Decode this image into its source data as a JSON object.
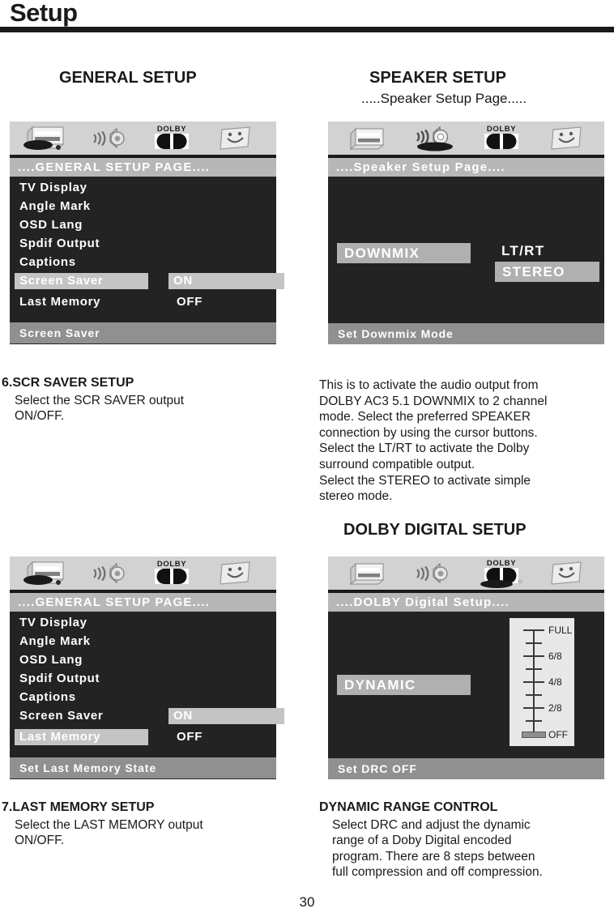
{
  "header": {
    "title": "Setup"
  },
  "page_number": "30",
  "sections": {
    "general_setup_heading": "GENERAL SETUP",
    "speaker_setup_heading": "SPEAKER SETUP",
    "speaker_setup_subheading": ".....Speaker Setup Page.....",
    "dolby_digital_heading": "DOLBY DIGITAL SETUP"
  },
  "icons": {
    "tv": "tv-display-icon",
    "speaker": "speaker-icon",
    "dolby": "dolby-icon",
    "preference": "preference-smiley-icon",
    "dolby_label": "DOLBY"
  },
  "panel_general_screensaver": {
    "title": "....GENERAL SETUP PAGE....",
    "menu": [
      {
        "label": "TV Display",
        "selected": false
      },
      {
        "label": "Angle Mark",
        "selected": false
      },
      {
        "label": "OSD Lang",
        "selected": false
      },
      {
        "label": "Spdif Output",
        "selected": false
      },
      {
        "label": "Captions",
        "selected": false
      },
      {
        "label": "Screen Saver",
        "selected": true
      },
      {
        "label": "Last Memory",
        "selected": false
      }
    ],
    "options": [
      {
        "label": "ON",
        "selected": true
      },
      {
        "label": "OFF",
        "selected": false
      }
    ],
    "status": "Screen Saver",
    "active_icon": "tv-display-icon"
  },
  "panel_speaker": {
    "title": "....Speaker Setup Page....",
    "field_label": "DOWNMIX",
    "options": [
      {
        "label": "LT/RT",
        "selected": false
      },
      {
        "label": "STEREO",
        "selected": true
      }
    ],
    "status": "Set Downmix Mode",
    "active_icon": "speaker-icon"
  },
  "panel_general_lastmemory": {
    "title": "....GENERAL SETUP PAGE....",
    "menu": [
      {
        "label": "TV Display",
        "selected": false
      },
      {
        "label": "Angle Mark",
        "selected": false
      },
      {
        "label": "OSD Lang",
        "selected": false
      },
      {
        "label": "Spdif Output",
        "selected": false
      },
      {
        "label": "Captions",
        "selected": false
      },
      {
        "label": "Screen Saver",
        "selected": false
      },
      {
        "label": "Last Memory",
        "selected": true
      }
    ],
    "options": [
      {
        "label": "ON",
        "selected": true
      },
      {
        "label": "OFF",
        "selected": false
      }
    ],
    "status": "Set Last Memory State",
    "active_icon": "tv-display-icon"
  },
  "panel_dolby_digital": {
    "title": "....DOLBY Digital Setup....",
    "field_label": "DYNAMIC",
    "slider": {
      "labels": [
        "FULL",
        "6/8",
        "4/8",
        "2/8",
        "OFF"
      ],
      "tick_count": 9,
      "handle_position": "OFF"
    },
    "status": "Set DRC OFF",
    "active_icon": "dolby-icon"
  },
  "copy": {
    "scr_saver": {
      "lead": "6.SCR SAVER SETUP",
      "body": "Select the SCR SAVER output\nON/OFF."
    },
    "last_memory": {
      "lead": "7.LAST MEMORY SETUP",
      "body": "Select the LAST MEMORY output\nON/OFF."
    },
    "downmix": {
      "body": "This is to activate the audio output from\nDOLBY AC3 5.1 DOWNMIX to 2 channel\nmode.  Select the preferred SPEAKER\nconnection by using the cursor buttons.\nSelect the LT/RT to activate the Dolby\nsurround compatible output.\nSelect the STEREO to activate simple\nstereo mode."
    },
    "drc": {
      "lead": "DYNAMIC RANGE CONTROL",
      "body": "Select DRC and adjust the dynamic\nrange of a Doby Digital encoded\nprogram.  There are 8 steps between\nfull compression and off compression."
    }
  }
}
